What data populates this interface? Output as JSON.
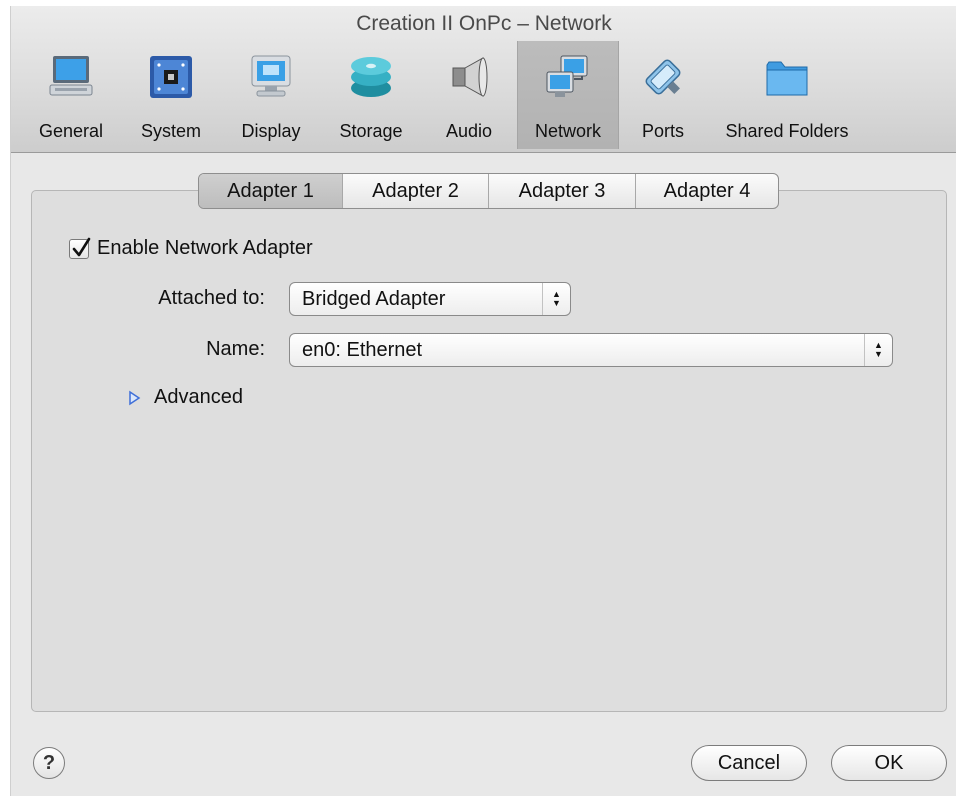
{
  "window": {
    "title": "Creation II OnPc – Network"
  },
  "toolbar": {
    "items": [
      {
        "label": "General",
        "icon": "monitor-icon",
        "selected": false
      },
      {
        "label": "System",
        "icon": "chip-icon",
        "selected": false
      },
      {
        "label": "Display",
        "icon": "display-icon",
        "selected": false
      },
      {
        "label": "Storage",
        "icon": "disks-icon",
        "selected": false
      },
      {
        "label": "Audio",
        "icon": "speaker-icon",
        "selected": false
      },
      {
        "label": "Network",
        "icon": "network-icon",
        "selected": true
      },
      {
        "label": "Ports",
        "icon": "ports-icon",
        "selected": false
      },
      {
        "label": "Shared Folders",
        "icon": "folder-icon",
        "selected": false
      }
    ]
  },
  "tabs": {
    "items": [
      "Adapter 1",
      "Adapter 2",
      "Adapter 3",
      "Adapter 4"
    ],
    "active": "Adapter 1"
  },
  "adapter": {
    "enable_label": "Enable Network Adapter",
    "enabled": true,
    "attached_label": "Attached to:",
    "attached_value": "Bridged Adapter",
    "name_label": "Name:",
    "name_value": "en0: Ethernet",
    "advanced_label": "Advanced"
  },
  "footer": {
    "help_label": "?",
    "cancel_label": "Cancel",
    "ok_label": "OK"
  },
  "colors": {
    "toolbar_selected": "#b8b8b8",
    "panel_bg": "#dedede",
    "disclosure_blue": "#3f6fd8"
  }
}
